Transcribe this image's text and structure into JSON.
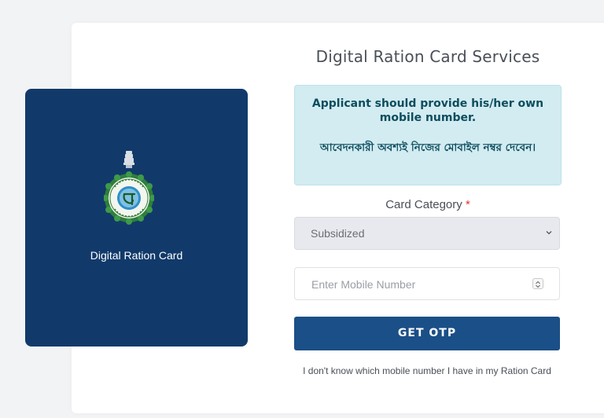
{
  "left_panel": {
    "emblem_icon": "west-bengal-government-emblem",
    "title": "Digital Ration Card"
  },
  "form": {
    "title": "Digital Ration Card Services",
    "alert_english": "Applicant should provide his/her own mobile number.",
    "alert_bengali": "আবেদনকারী অবশ্যই নিজের মোবাইল নম্বর দেবেন।",
    "category_label": "Card Category",
    "required_marker": "*",
    "category_selected": "Subsidized",
    "mobile_placeholder": "Enter Mobile Number",
    "mobile_value": "",
    "otp_button": "GET OTP",
    "help_link": "I don't know which mobile number I have in my Ration Card"
  },
  "colors": {
    "panel_bg": "#113a6b",
    "button_bg": "#1b4f87",
    "alert_bg": "#d2ecf1",
    "required": "#e0332d"
  }
}
